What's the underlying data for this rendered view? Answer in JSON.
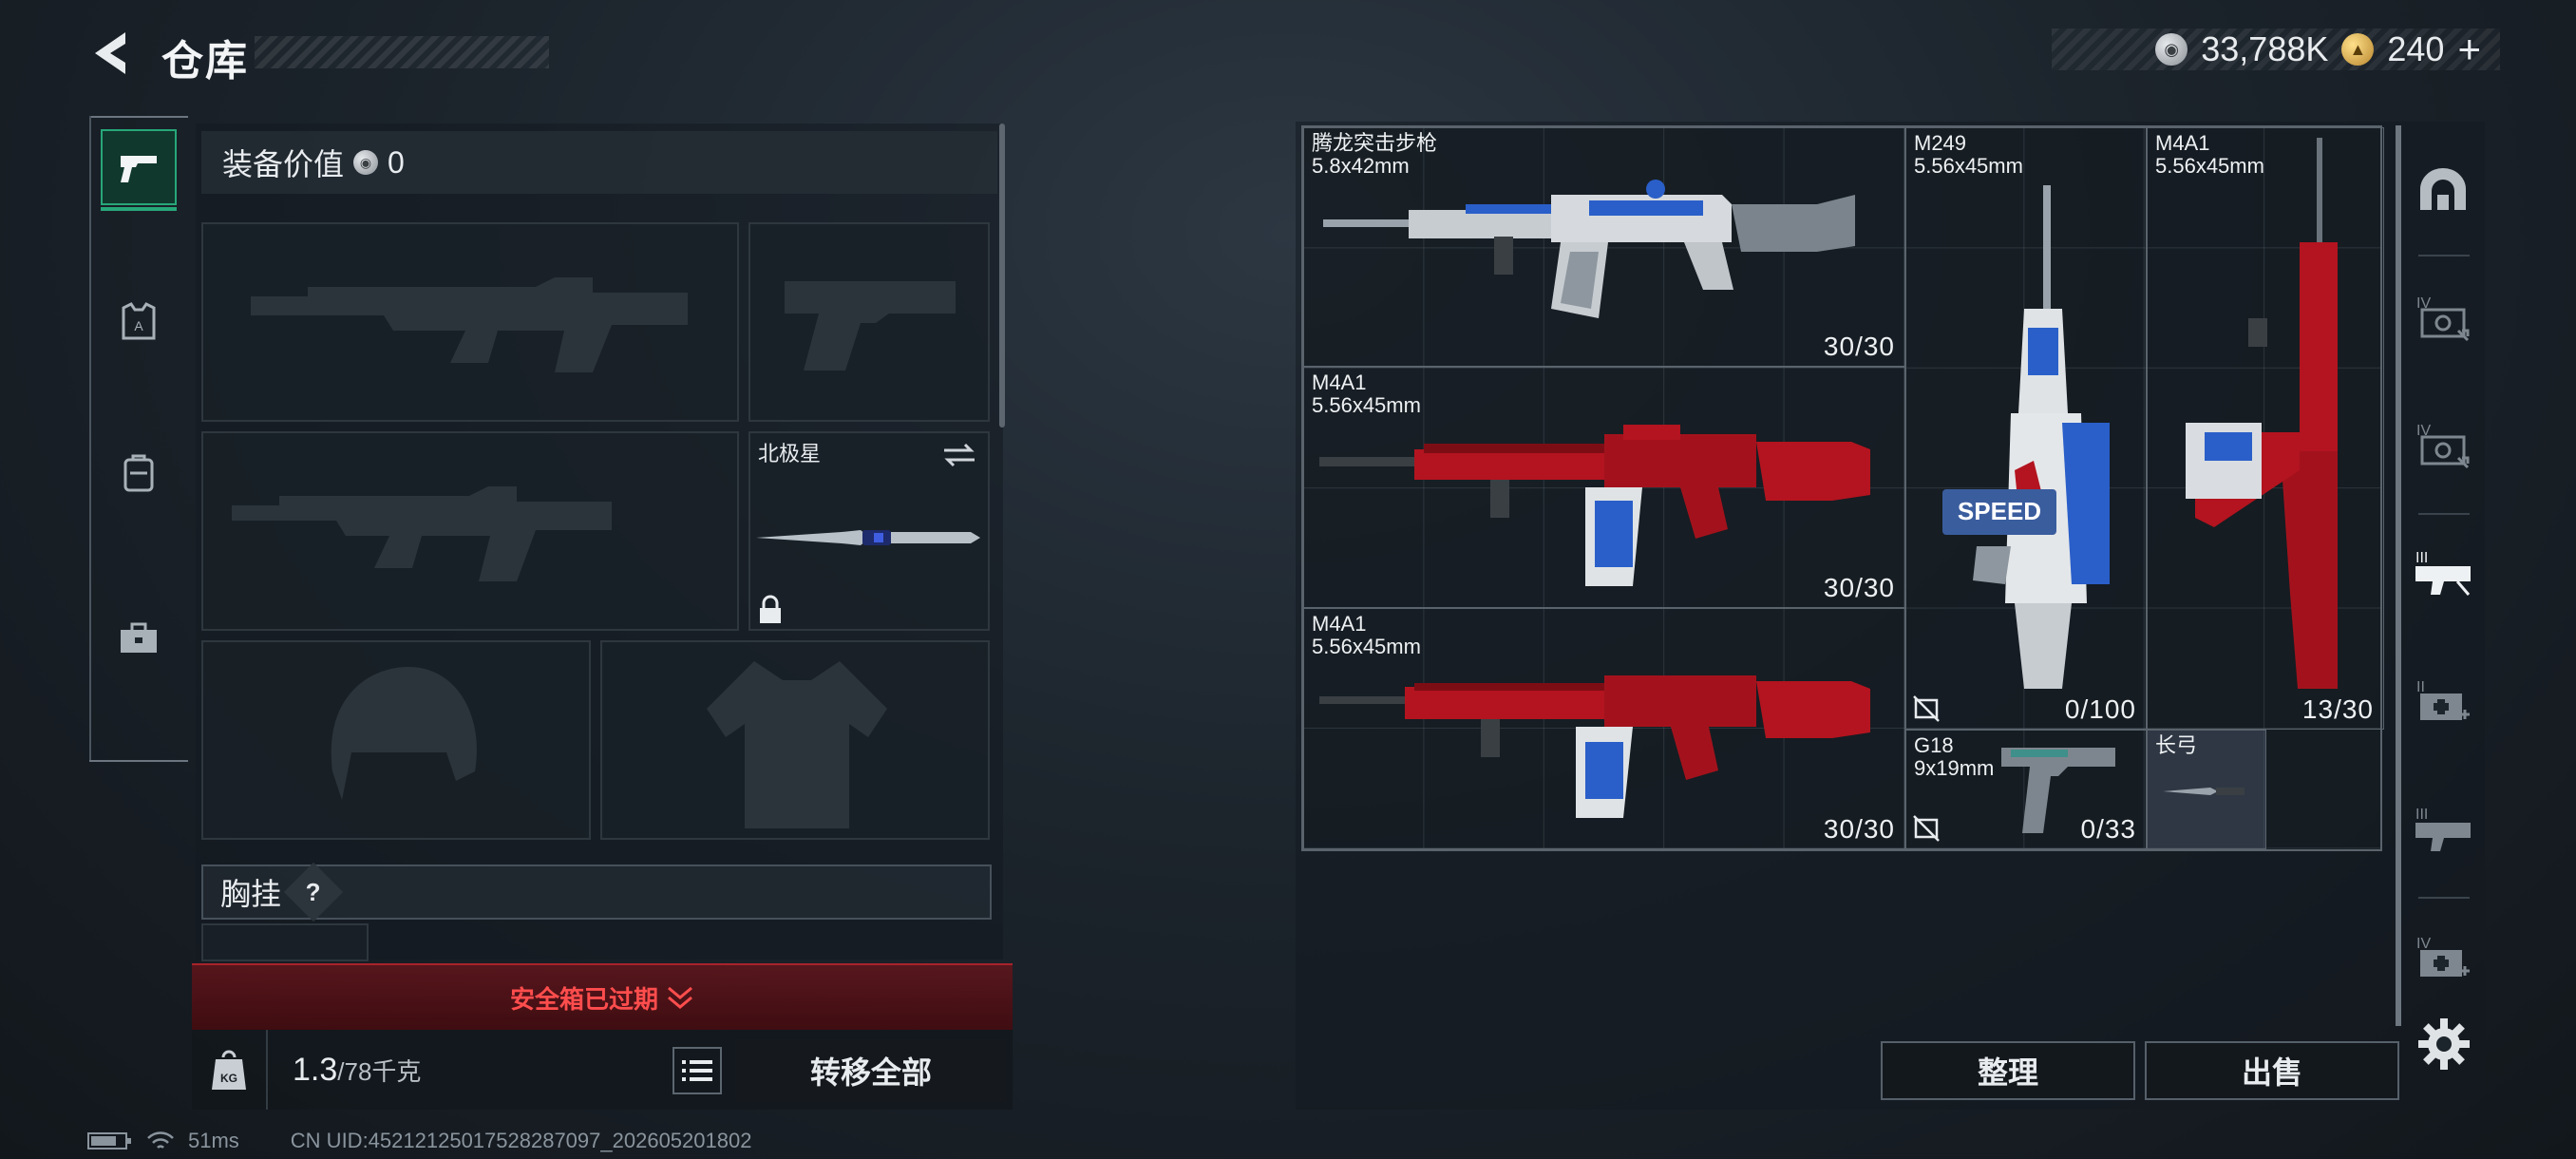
{
  "header": {
    "title": "仓库",
    "currency_silver": "33,788K",
    "currency_gold": "240",
    "currency_plus": "+"
  },
  "equipment": {
    "value_label": "装备价值",
    "value": "0",
    "knife_name": "北极星",
    "chest_rig_label": "胸挂",
    "help_mark": "?"
  },
  "safebox": {
    "text": "安全箱已过期"
  },
  "weight": {
    "current": "1.3",
    "max": "/78千克",
    "badge": "KG"
  },
  "actions": {
    "transfer_all": "转移全部",
    "sort": "整理",
    "sell": "出售"
  },
  "status": {
    "ping": "51ms",
    "uid": "CN UID:45212125017528287097_202605201802"
  },
  "stash_items": [
    {
      "name": "腾龙突击步枪",
      "caliber": "5.8x42mm",
      "ammo": "30/30"
    },
    {
      "name": "M249",
      "caliber": "5.56x45mm",
      "ammo": "0/100",
      "decal": "SPEED"
    },
    {
      "name": "M4A1",
      "caliber": "5.56x45mm",
      "ammo": "13/30"
    },
    {
      "name": "M4A1",
      "caliber": "5.56x45mm",
      "ammo": "30/30"
    },
    {
      "name": "M4A1",
      "caliber": "5.56x45mm",
      "ammo": "30/30"
    },
    {
      "name": "G18",
      "caliber": "9x19mm",
      "ammo": "0/33"
    },
    {
      "name": "长弓",
      "caliber": "",
      "ammo": ""
    }
  ],
  "colors": {
    "accent_green": "#27a779",
    "warning_red": "#ff4d4d",
    "weapon_red": "#b3141f",
    "weapon_blue": "#2a5fc9"
  }
}
